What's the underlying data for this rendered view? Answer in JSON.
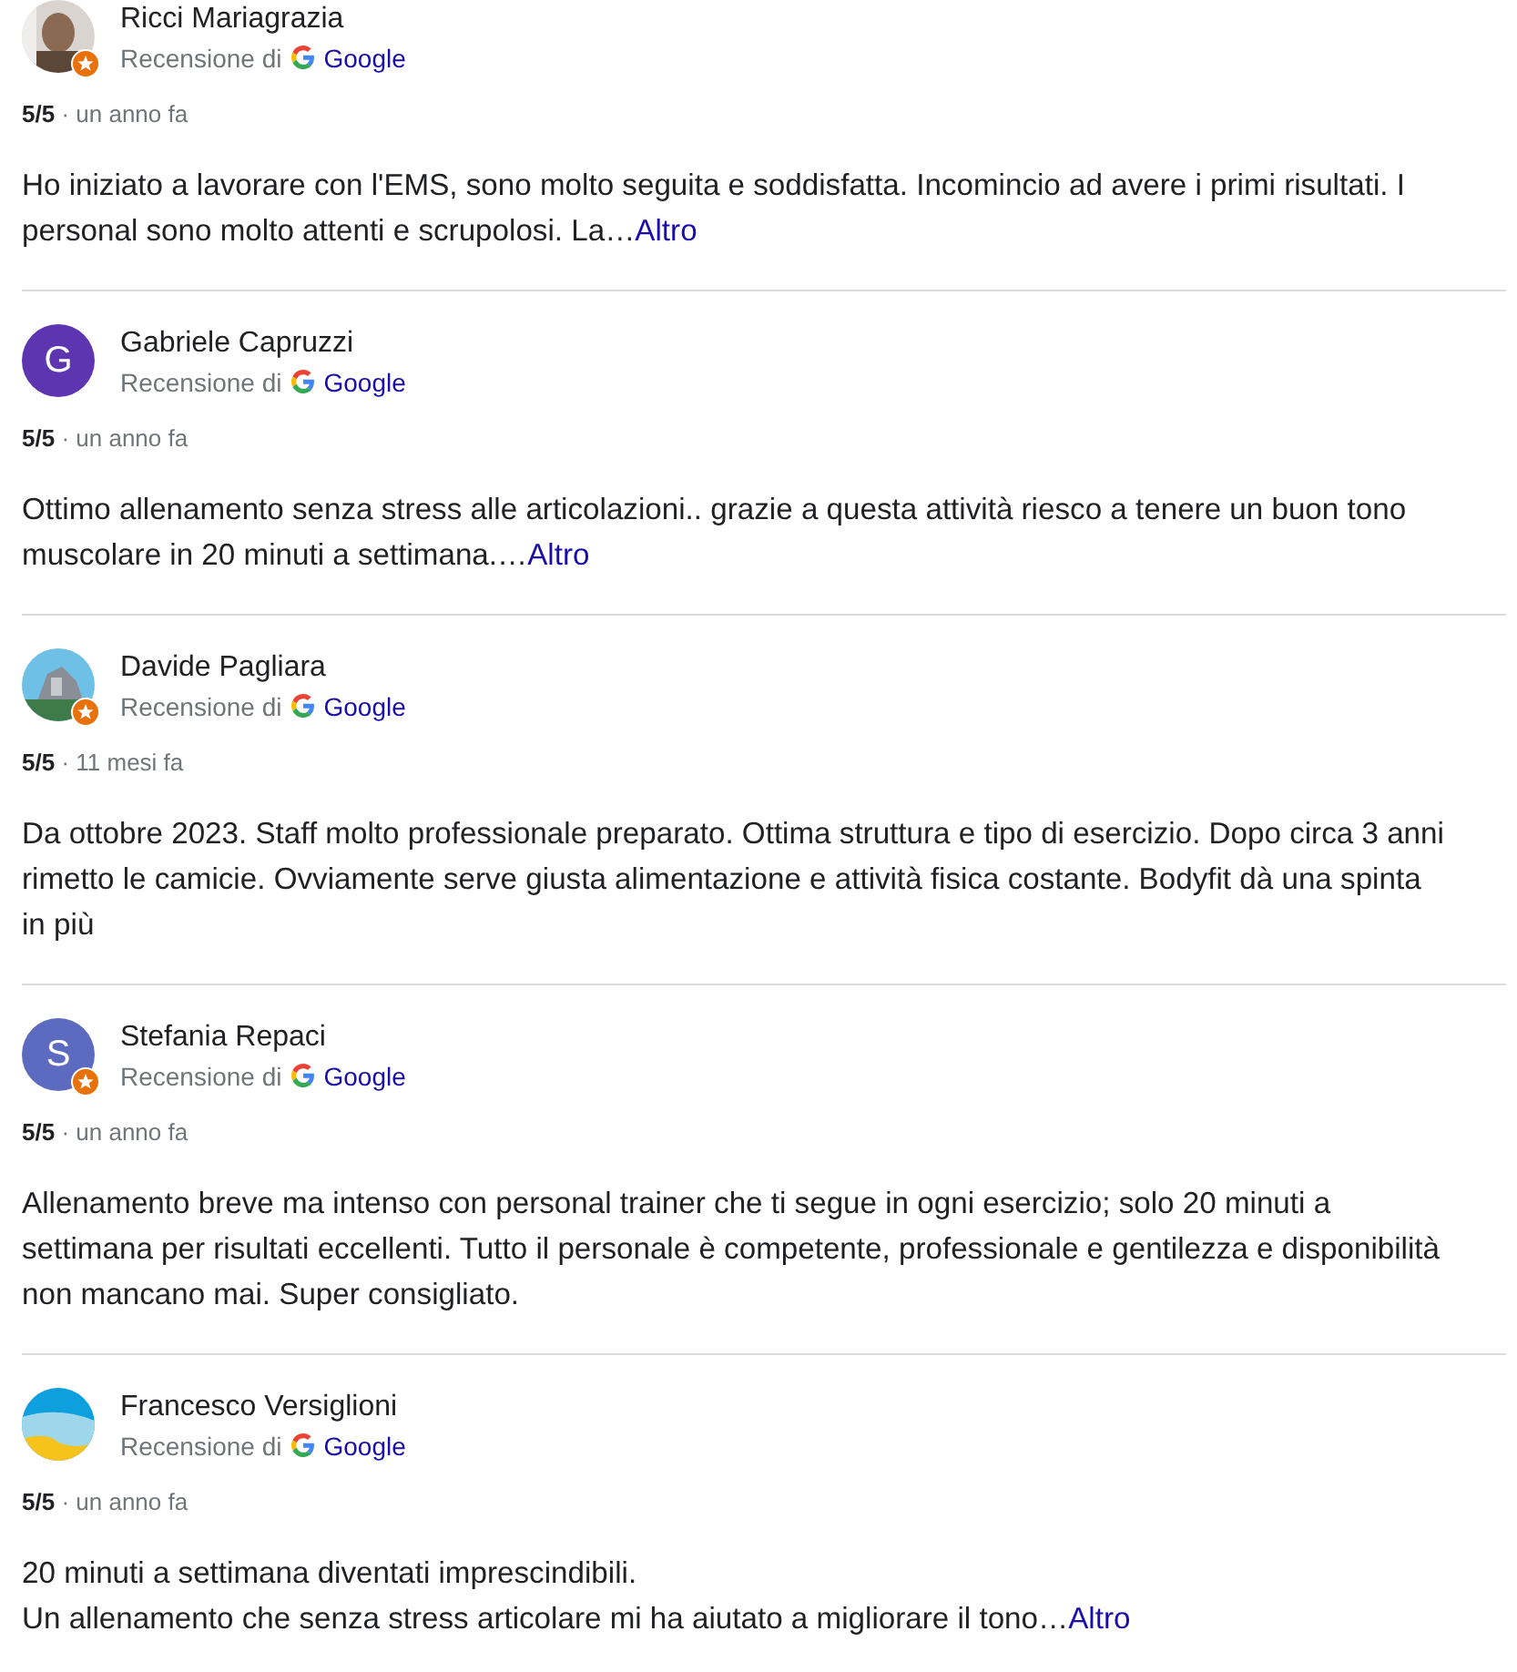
{
  "reviews": [
    {
      "author": "Ricci Mariagrazia",
      "local_guide": true,
      "source_label": "Recensione di",
      "source": "Google",
      "rating": "5/5",
      "separator": "·",
      "time": "un anno fa",
      "text": "Ho iniziato a lavorare con l'EMS, sono molto seguita e soddisfatta. Incomincio ad avere i primi risultati. I personal sono molto attenti e scrupolosi. La…",
      "more_link": "Altro"
    },
    {
      "author": "Gabriele Capruzzi",
      "avatar": {
        "kind": "letter",
        "letter": "G",
        "color": "#5e35b1"
      },
      "local_guide": false,
      "source_label": "Recensione di",
      "source": "Google",
      "rating": "5/5",
      "separator": "·",
      "time": "un anno fa",
      "text": "Ottimo allenamento senza stress alle articolazioni.. grazie a questa attività riesco a tenere un buon tono muscolare in 20 minuti a settimana.…",
      "more_link": "Altro"
    },
    {
      "author": "Davide Pagliara",
      "local_guide": true,
      "source_label": "Recensione di",
      "source": "Google",
      "rating": "5/5",
      "separator": "·",
      "time": "11 mesi fa",
      "text": "Da ottobre 2023. Staff molto professionale preparato. Ottima struttura e tipo di esercizio. Dopo circa 3 anni rimetto le camicie. Ovviamente serve giusta alimentazione e attività fisica costante. Bodyfit dà una spinta in più"
    },
    {
      "author": "Stefania Repaci",
      "avatar": {
        "kind": "letter",
        "letter": "S",
        "color": "#5c6bc0"
      },
      "local_guide": true,
      "source_label": "Recensione di",
      "source": "Google",
      "rating": "5/5",
      "separator": "·",
      "time": "un anno fa",
      "text": "Allenamento breve ma intenso con personal trainer che ti segue in ogni esercizio; solo 20 minuti a settimana per risultati eccellenti. Tutto il personale è competente, professionale e gentilezza e disponibilità non mancano mai. Super consigliato."
    },
    {
      "author": "Francesco Versiglioni",
      "local_guide": false,
      "source_label": "Recensione di",
      "source": "Google",
      "rating": "5/5",
      "separator": "·",
      "time": "un anno fa",
      "text": "20 minuti a settimana diventati imprescindibili.\nUn allenamento che senza stress articolare mi ha aiutato a migliorare il tono…",
      "more_link": "Altro"
    }
  ]
}
